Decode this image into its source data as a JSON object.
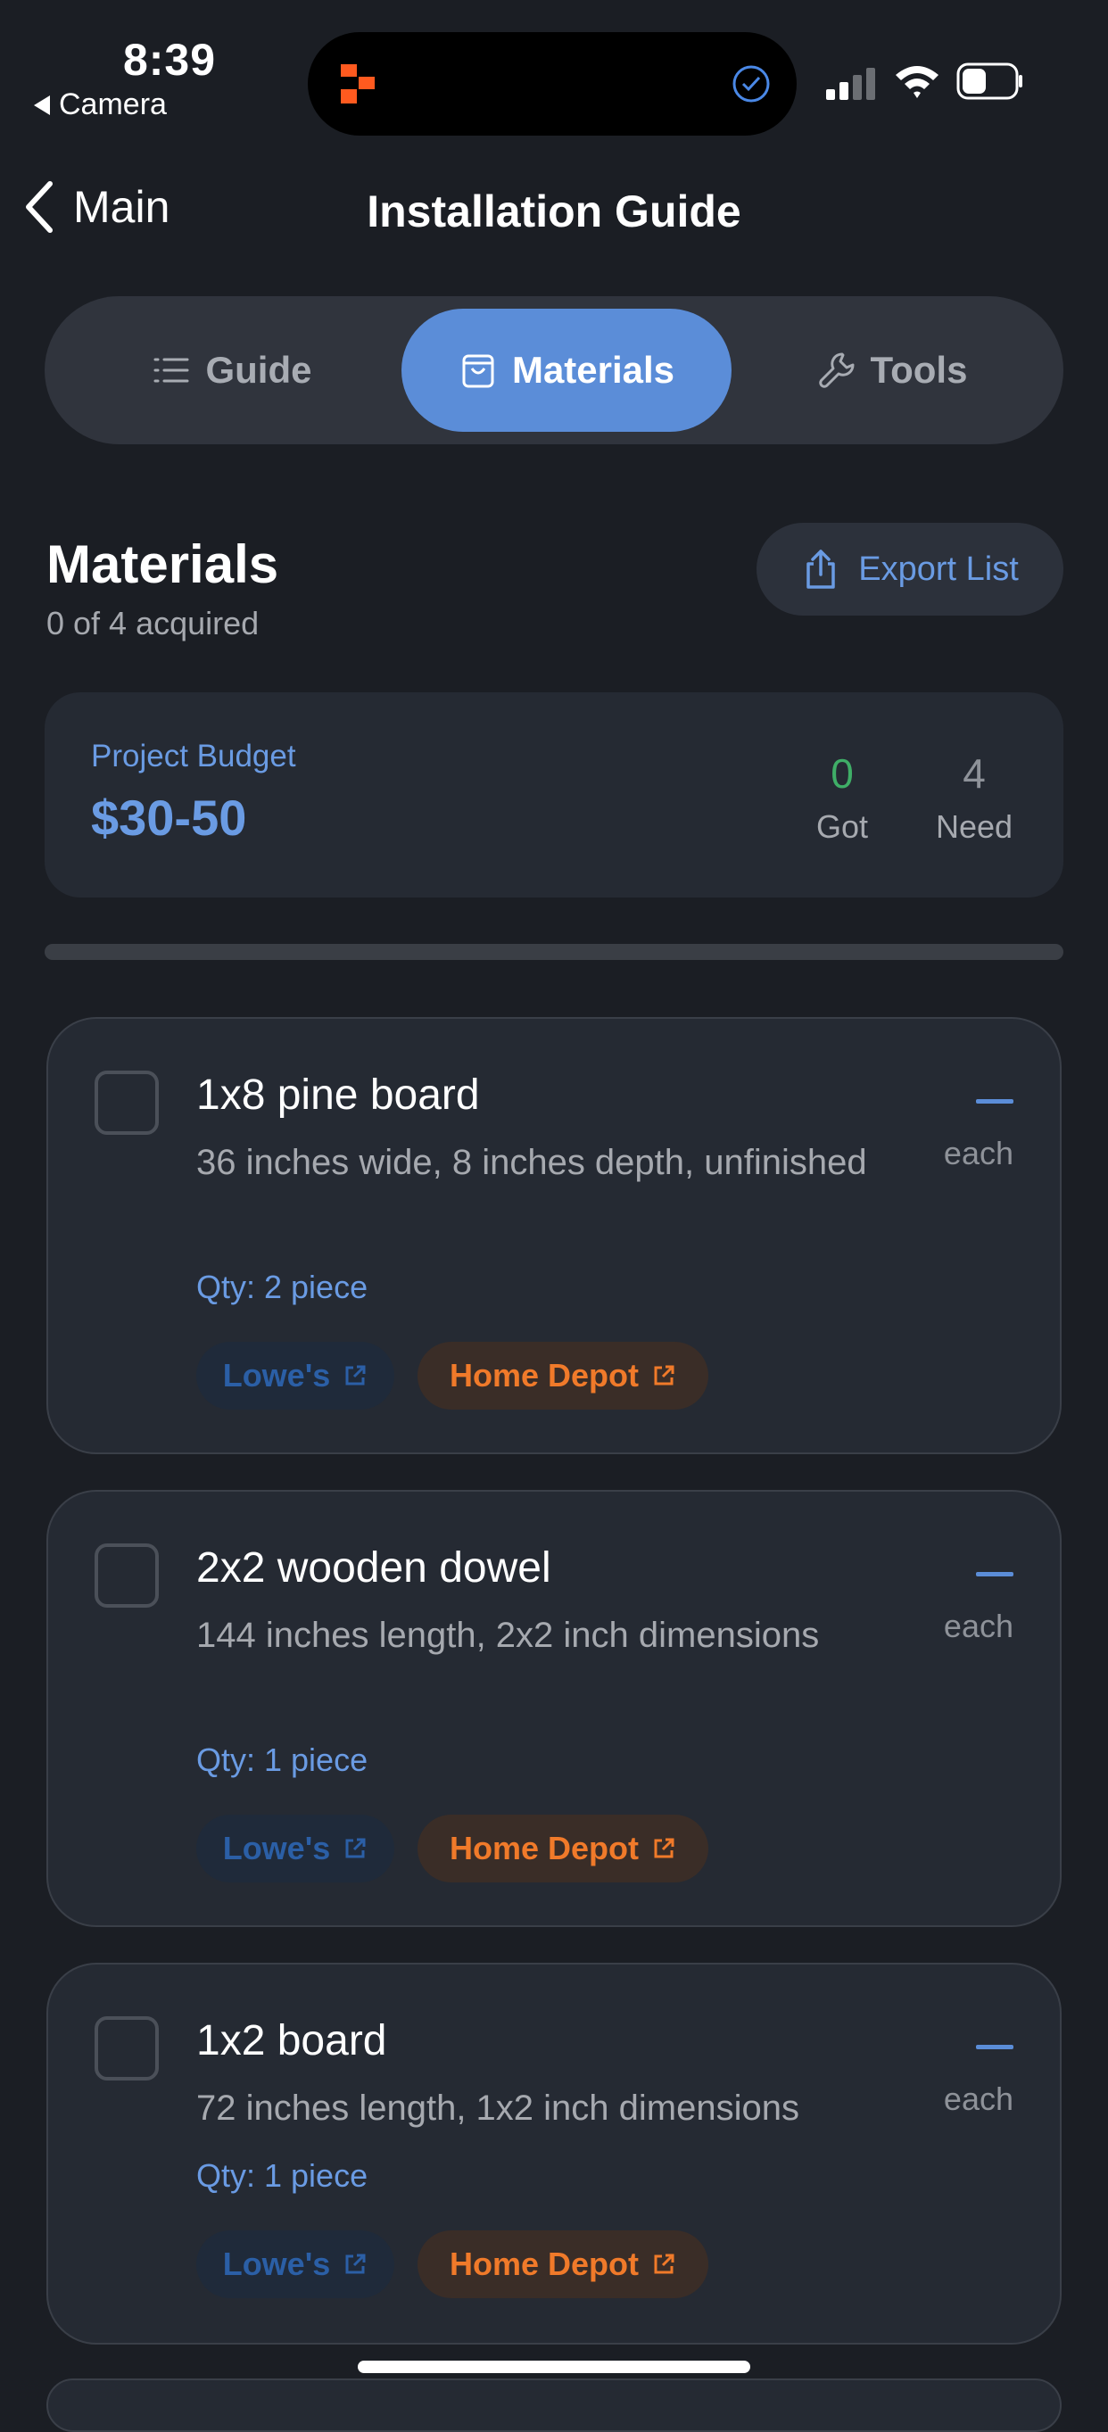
{
  "status_bar": {
    "time": "8:39",
    "back_app": "Camera"
  },
  "nav": {
    "back_label": "Main",
    "title": "Installation Guide"
  },
  "tabs": [
    {
      "label": "Guide",
      "icon": "list-icon",
      "active": false
    },
    {
      "label": "Materials",
      "icon": "bag-icon",
      "active": true
    },
    {
      "label": "Tools",
      "icon": "wrench-icon",
      "active": false
    }
  ],
  "header": {
    "title": "Materials",
    "subtitle": "0 of 4 acquired",
    "export_label": "Export List"
  },
  "budget": {
    "label": "Project Budget",
    "value": "$30-50",
    "got_count": "0",
    "got_label": "Got",
    "need_count": "4",
    "need_label": "Need"
  },
  "progress": {
    "fraction": 0
  },
  "materials": [
    {
      "name": "1x8 pine board",
      "desc": "36 inches wide, 8 inches depth, unfinished",
      "qty": "Qty: 2 piece",
      "price": "—",
      "unit": "each",
      "store1": "Lowe's",
      "store2": "Home Depot"
    },
    {
      "name": "2x2 wooden dowel",
      "desc": "144 inches length, 2x2 inch dimensions",
      "qty": "Qty: 1 piece",
      "price": "—",
      "unit": "each",
      "store1": "Lowe's",
      "store2": "Home Depot"
    },
    {
      "name": "1x2 board",
      "desc": "72 inches length, 1x2 inch dimensions",
      "qty": "Qty: 1 piece",
      "price": "—",
      "unit": "each",
      "store1": "Lowe's",
      "store2": "Home Depot"
    }
  ],
  "colors": {
    "accent": "#5b8dd8",
    "link_blue": "#6a9be3",
    "got_green": "#3fae67",
    "home_depot_orange": "#f07a2a",
    "background": "#1b1e24"
  }
}
